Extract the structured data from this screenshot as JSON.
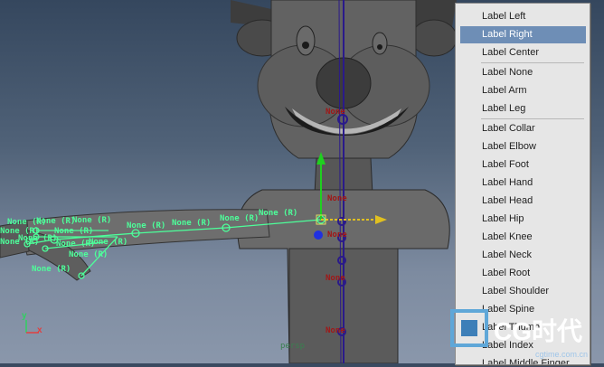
{
  "viewport": {
    "joint_label_text": "None",
    "joint_side_suffix": "(R)",
    "axis_y": "y",
    "axis_x": "x",
    "footer_text": "persp"
  },
  "context_menu": {
    "items": [
      {
        "label": "Label Left",
        "selected": false
      },
      {
        "label": "Label Right",
        "selected": true
      },
      {
        "label": "Label Center",
        "selected": false
      },
      {
        "label": "Label None",
        "selected": false
      },
      {
        "label": "Label Arm",
        "selected": false
      },
      {
        "label": "Label Leg",
        "selected": false
      },
      {
        "label": "Label Collar",
        "selected": false
      },
      {
        "label": "Label Elbow",
        "selected": false
      },
      {
        "label": "Label Foot",
        "selected": false
      },
      {
        "label": "Label Hand",
        "selected": false
      },
      {
        "label": "Label Head",
        "selected": false
      },
      {
        "label": "Label Hip",
        "selected": false
      },
      {
        "label": "Label Knee",
        "selected": false
      },
      {
        "label": "Label Neck",
        "selected": false
      },
      {
        "label": "Label Root",
        "selected": false
      },
      {
        "label": "Label Shoulder",
        "selected": false
      },
      {
        "label": "Label Spine",
        "selected": false
      },
      {
        "label": "Label Thumb",
        "selected": false
      },
      {
        "label": "Label Index",
        "selected": false
      },
      {
        "label": "Label Middle Finger",
        "selected": false
      }
    ]
  },
  "watermark": {
    "brand": "CG时代",
    "url": "cgtime.com.cn"
  },
  "colors": {
    "selection": "#6e8eb6",
    "joint_green": "#4dff9a",
    "spine_label": "#a01818",
    "skeleton": "#2a1a8a"
  }
}
